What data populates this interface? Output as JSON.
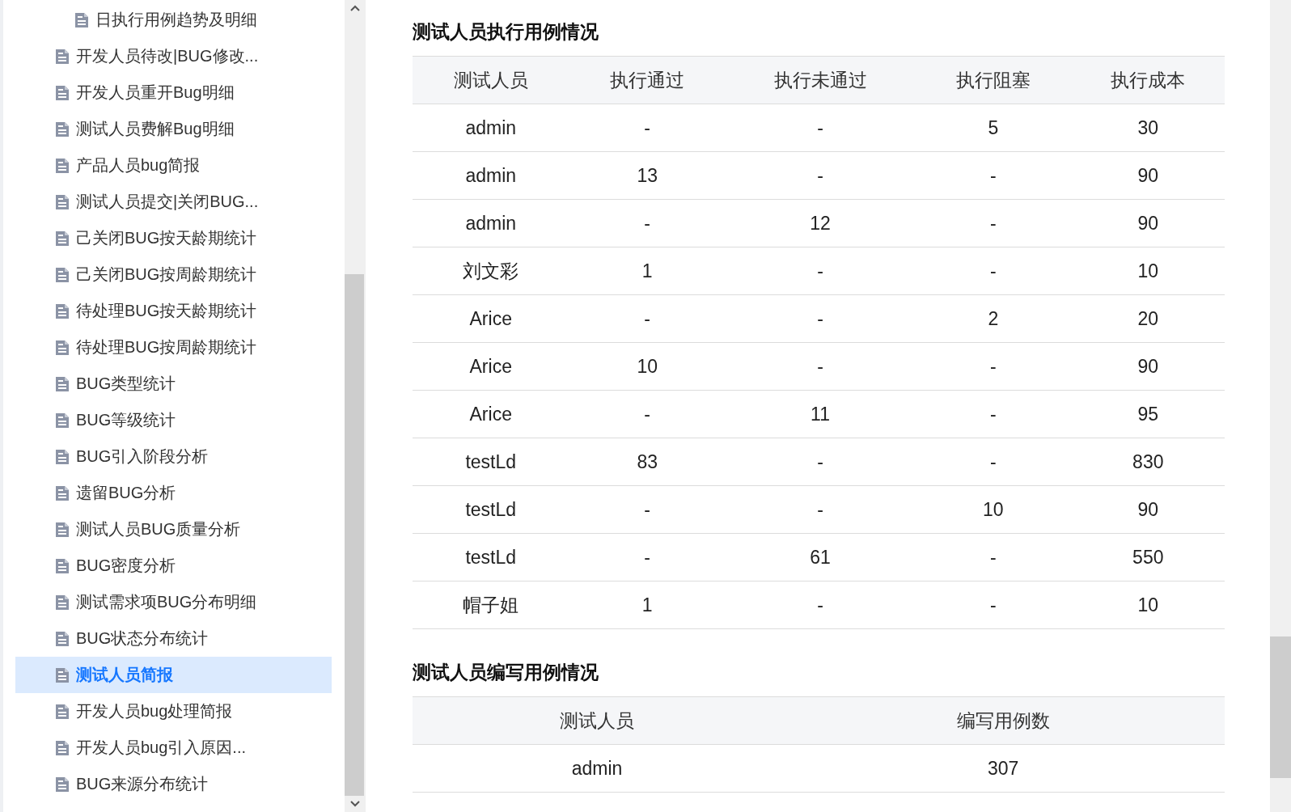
{
  "sidebar": {
    "items": [
      {
        "label": "日执行用例趋势及明细",
        "kind": "sub",
        "selected": false
      },
      {
        "label": "开发人员待改|BUG修改...",
        "kind": "page",
        "selected": false
      },
      {
        "label": "开发人员重开Bug明细",
        "kind": "page",
        "selected": false
      },
      {
        "label": "测试人员费解Bug明细",
        "kind": "page",
        "selected": false
      },
      {
        "label": "产品人员bug简报",
        "kind": "page",
        "selected": false
      },
      {
        "label": "测试人员提交|关闭BUG...",
        "kind": "page",
        "selected": false
      },
      {
        "label": "己关闭BUG按天龄期统计",
        "kind": "page",
        "selected": false
      },
      {
        "label": "己关闭BUG按周龄期统计",
        "kind": "page",
        "selected": false
      },
      {
        "label": "待处理BUG按天龄期统计",
        "kind": "page",
        "selected": false
      },
      {
        "label": "待处理BUG按周龄期统计",
        "kind": "page",
        "selected": false
      },
      {
        "label": "BUG类型统计",
        "kind": "page",
        "selected": false
      },
      {
        "label": "BUG等级统计",
        "kind": "page",
        "selected": false
      },
      {
        "label": "BUG引入阶段分析",
        "kind": "page",
        "selected": false
      },
      {
        "label": "遗留BUG分析",
        "kind": "page",
        "selected": false
      },
      {
        "label": "测试人员BUG质量分析",
        "kind": "page",
        "selected": false
      },
      {
        "label": "BUG密度分析",
        "kind": "page",
        "selected": false
      },
      {
        "label": "测试需求项BUG分布明细",
        "kind": "page",
        "selected": false
      },
      {
        "label": "BUG状态分布统计",
        "kind": "page",
        "selected": false
      },
      {
        "label": "测试人员简报",
        "kind": "page",
        "selected": true
      },
      {
        "label": "开发人员bug处理简报",
        "kind": "page",
        "selected": false
      },
      {
        "label": "开发人员bug引入原因...",
        "kind": "page",
        "selected": false
      },
      {
        "label": "BUG来源分布统计",
        "kind": "page",
        "selected": false
      }
    ]
  },
  "sections": [
    {
      "title": "测试人员执行用例情况",
      "columns": [
        "测试人员",
        "执行通过",
        "执行未通过",
        "执行阻塞",
        "执行成本"
      ],
      "rows": [
        [
          "admin",
          "-",
          "-",
          "5",
          "30"
        ],
        [
          "admin",
          "13",
          "-",
          "-",
          "90"
        ],
        [
          "admin",
          "-",
          "12",
          "-",
          "90"
        ],
        [
          "刘文彩",
          "1",
          "-",
          "-",
          "10"
        ],
        [
          "Arice",
          "-",
          "-",
          "2",
          "20"
        ],
        [
          "Arice",
          "10",
          "-",
          "-",
          "90"
        ],
        [
          "Arice",
          "-",
          "11",
          "-",
          "95"
        ],
        [
          "testLd",
          "83",
          "-",
          "-",
          "830"
        ],
        [
          "testLd",
          "-",
          "-",
          "10",
          "90"
        ],
        [
          "testLd",
          "-",
          "61",
          "-",
          "550"
        ],
        [
          "帽子姐",
          "1",
          "-",
          "-",
          "10"
        ]
      ]
    },
    {
      "title": "测试人员编写用例情况",
      "columns": [
        "测试人员",
        "编写用例数"
      ],
      "rows": [
        [
          "admin",
          "307"
        ]
      ]
    }
  ]
}
